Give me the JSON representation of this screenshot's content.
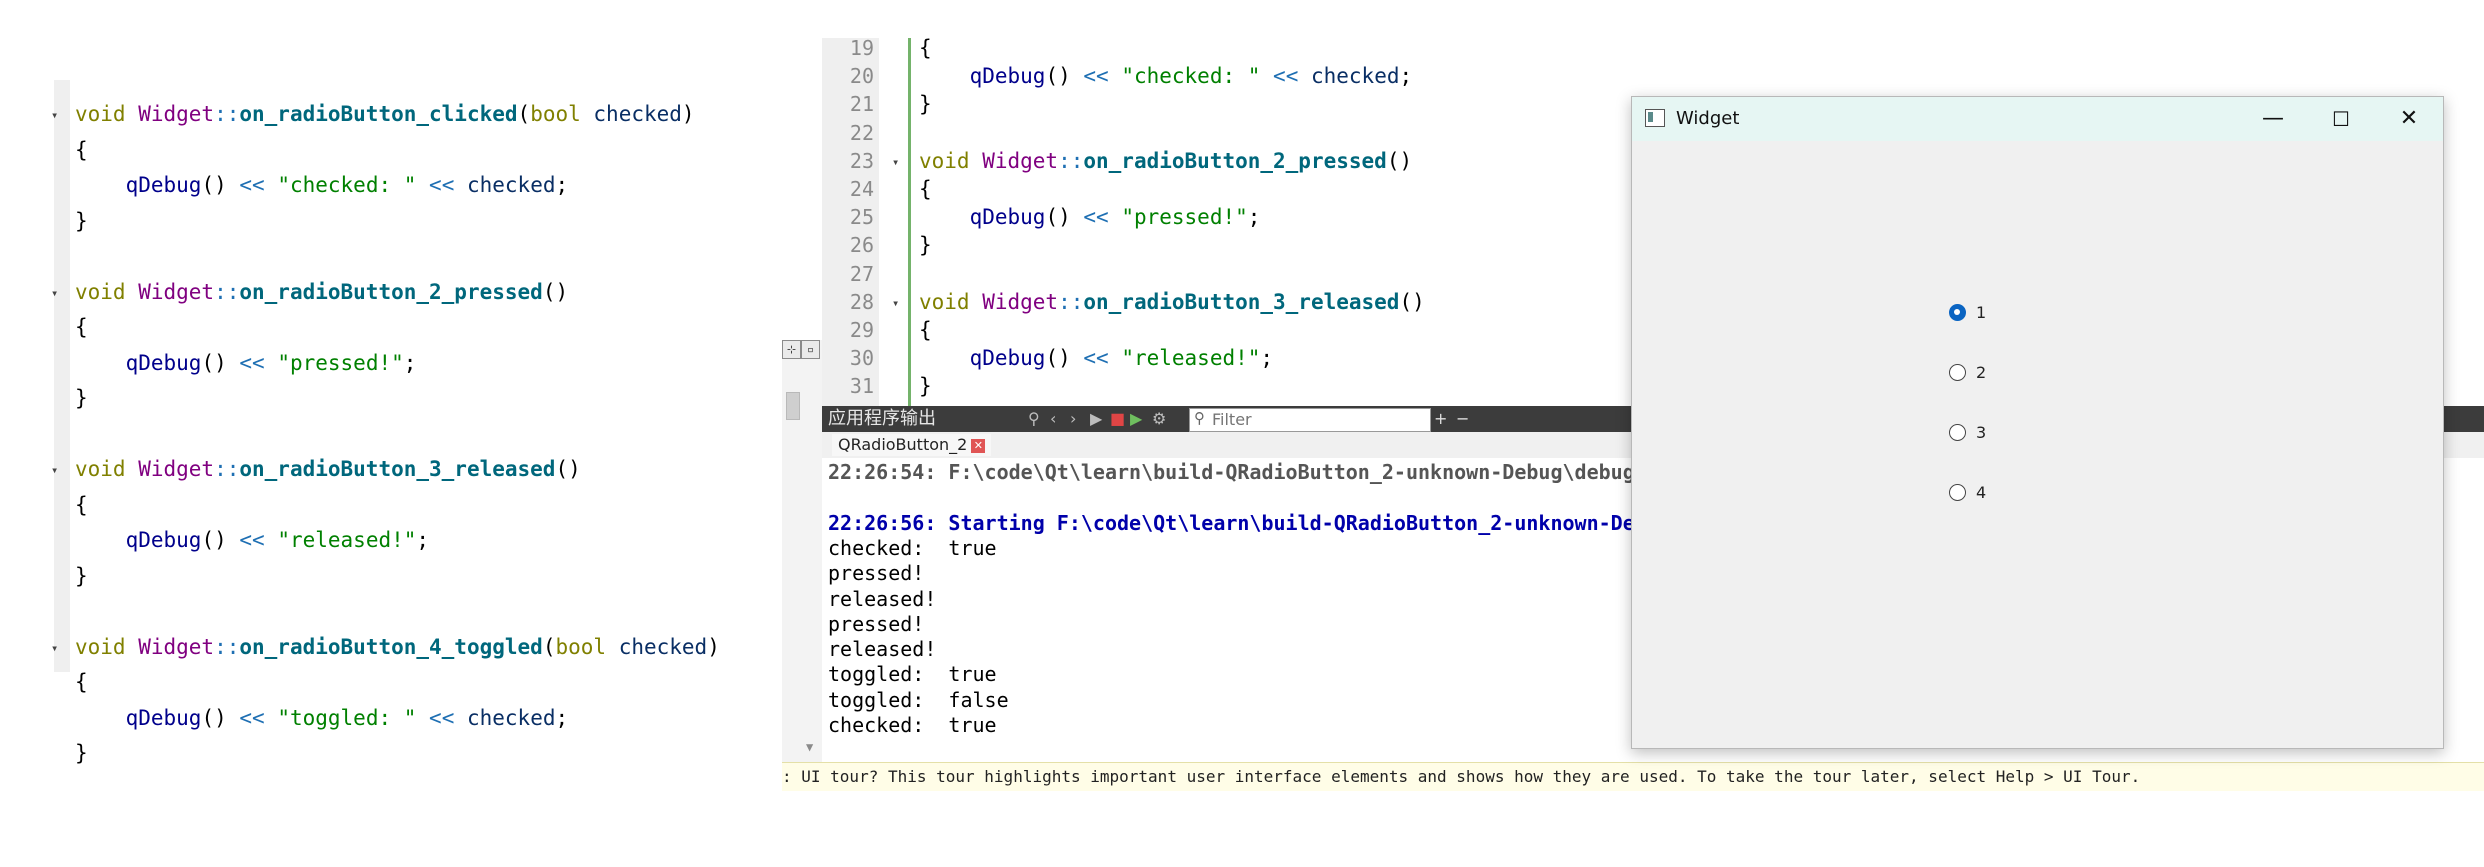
{
  "left_snippet": {
    "lines": [
      {
        "fold": true,
        "parts": [
          [
            "kw",
            "void "
          ],
          [
            "cls",
            "Widget"
          ],
          [
            "op",
            "::"
          ],
          [
            "fn",
            "on_radioButton_clicked"
          ],
          [
            "",
            "("
          ],
          [
            "kw",
            "bool "
          ],
          [
            "pm",
            "checked"
          ],
          [
            "",
            ")"
          ]
        ]
      },
      {
        "fold": false,
        "parts": [
          [
            "",
            "{"
          ]
        ]
      },
      {
        "fold": false,
        "parts": [
          [
            "",
            "    "
          ],
          [
            "call",
            "qDebug"
          ],
          [
            "",
            "() "
          ],
          [
            "op",
            "<<"
          ],
          [
            "str",
            " \"checked: \" "
          ],
          [
            "op",
            "<<"
          ],
          [
            "pm",
            " checked"
          ],
          [
            "",
            ";"
          ]
        ]
      },
      {
        "fold": false,
        "parts": [
          [
            "",
            "}"
          ]
        ]
      },
      {
        "fold": false,
        "parts": []
      },
      {
        "fold": true,
        "parts": [
          [
            "kw",
            "void "
          ],
          [
            "cls",
            "Widget"
          ],
          [
            "op",
            "::"
          ],
          [
            "fn",
            "on_radioButton_2_pressed"
          ],
          [
            "",
            "()"
          ]
        ]
      },
      {
        "fold": false,
        "parts": [
          [
            "",
            "{"
          ]
        ]
      },
      {
        "fold": false,
        "parts": [
          [
            "",
            "    "
          ],
          [
            "call",
            "qDebug"
          ],
          [
            "",
            "() "
          ],
          [
            "op",
            "<<"
          ],
          [
            "str",
            " \"pressed!\""
          ],
          [
            "",
            ";"
          ]
        ]
      },
      {
        "fold": false,
        "parts": [
          [
            "",
            "}"
          ]
        ]
      },
      {
        "fold": false,
        "parts": []
      },
      {
        "fold": true,
        "parts": [
          [
            "kw",
            "void "
          ],
          [
            "cls",
            "Widget"
          ],
          [
            "op",
            "::"
          ],
          [
            "fn",
            "on_radioButton_3_released"
          ],
          [
            "",
            "()"
          ]
        ]
      },
      {
        "fold": false,
        "parts": [
          [
            "",
            "{"
          ]
        ]
      },
      {
        "fold": false,
        "parts": [
          [
            "",
            "    "
          ],
          [
            "call",
            "qDebug"
          ],
          [
            "",
            "() "
          ],
          [
            "op",
            "<<"
          ],
          [
            "str",
            " \"released!\""
          ],
          [
            "",
            ";"
          ]
        ]
      },
      {
        "fold": false,
        "parts": [
          [
            "",
            "}"
          ]
        ]
      },
      {
        "fold": false,
        "parts": []
      },
      {
        "fold": true,
        "parts": [
          [
            "kw",
            "void "
          ],
          [
            "cls",
            "Widget"
          ],
          [
            "op",
            "::"
          ],
          [
            "fn",
            "on_radioButton_4_toggled"
          ],
          [
            "",
            "("
          ],
          [
            "kw",
            "bool "
          ],
          [
            "pm",
            "checked"
          ],
          [
            "",
            ")"
          ]
        ]
      },
      {
        "fold": false,
        "parts": [
          [
            "",
            "{"
          ]
        ]
      },
      {
        "fold": false,
        "parts": [
          [
            "",
            "    "
          ],
          [
            "call",
            "qDebug"
          ],
          [
            "",
            "() "
          ],
          [
            "op",
            "<<"
          ],
          [
            "str",
            " \"toggled: \" "
          ],
          [
            "op",
            "<<"
          ],
          [
            "pm",
            " checked"
          ],
          [
            "",
            ";"
          ]
        ]
      },
      {
        "fold": false,
        "parts": [
          [
            "",
            "}"
          ]
        ]
      }
    ]
  },
  "editor": {
    "lines": [
      {
        "num": "19",
        "fold": false,
        "parts": [
          [
            "",
            "{"
          ]
        ]
      },
      {
        "num": "20",
        "fold": false,
        "parts": [
          [
            "",
            "    "
          ],
          [
            "call",
            "qDebug"
          ],
          [
            "",
            "() "
          ],
          [
            "op",
            "<<"
          ],
          [
            "str",
            " \"checked: \" "
          ],
          [
            "op",
            "<<"
          ],
          [
            "pm",
            " checked"
          ],
          [
            "",
            ";"
          ]
        ]
      },
      {
        "num": "21",
        "fold": false,
        "parts": [
          [
            "",
            "}"
          ]
        ]
      },
      {
        "num": "22",
        "fold": false,
        "parts": []
      },
      {
        "num": "23",
        "fold": true,
        "parts": [
          [
            "kw",
            "void "
          ],
          [
            "cls",
            "Widget"
          ],
          [
            "op",
            "::"
          ],
          [
            "fn",
            "on_radioButton_2_pressed"
          ],
          [
            "",
            "()"
          ]
        ]
      },
      {
        "num": "24",
        "fold": false,
        "parts": [
          [
            "",
            "{"
          ]
        ]
      },
      {
        "num": "25",
        "fold": false,
        "parts": [
          [
            "",
            "    "
          ],
          [
            "call",
            "qDebug"
          ],
          [
            "",
            "() "
          ],
          [
            "op",
            "<<"
          ],
          [
            "str",
            " \"pressed!\""
          ],
          [
            "",
            ";"
          ]
        ]
      },
      {
        "num": "26",
        "fold": false,
        "parts": [
          [
            "",
            "}"
          ]
        ]
      },
      {
        "num": "27",
        "fold": false,
        "parts": []
      },
      {
        "num": "28",
        "fold": true,
        "parts": [
          [
            "kw",
            "void "
          ],
          [
            "cls",
            "Widget"
          ],
          [
            "op",
            "::"
          ],
          [
            "fn",
            "on_radioButton_3_released"
          ],
          [
            "",
            "()"
          ]
        ]
      },
      {
        "num": "29",
        "fold": false,
        "parts": [
          [
            "",
            "{"
          ]
        ]
      },
      {
        "num": "30",
        "fold": false,
        "parts": [
          [
            "",
            "    "
          ],
          [
            "call",
            "qDebug"
          ],
          [
            "",
            "() "
          ],
          [
            "op",
            "<<"
          ],
          [
            "str",
            " \"released!\""
          ],
          [
            "",
            ";"
          ]
        ]
      },
      {
        "num": "31",
        "fold": false,
        "parts": [
          [
            "",
            "}"
          ]
        ]
      }
    ]
  },
  "output_pane": {
    "title": "应用程序输出",
    "filter_placeholder": "Filter",
    "tab_label": "QRadioButton_2",
    "lines": [
      {
        "style": "gray",
        "text": "22:26:54: F:\\code\\Qt\\learn\\build-QRadioButton_2-unknown-Debug\\debug"
      },
      {
        "style": "",
        "text": ""
      },
      {
        "style": "blue",
        "text": "22:26:56: Starting F:\\code\\Qt\\learn\\build-QRadioButton_2-unknown-De"
      },
      {
        "style": "",
        "text": "checked:  true"
      },
      {
        "style": "",
        "text": "pressed!"
      },
      {
        "style": "",
        "text": "released!"
      },
      {
        "style": "",
        "text": "pressed!"
      },
      {
        "style": "",
        "text": "released!"
      },
      {
        "style": "",
        "text": "toggled:  true"
      },
      {
        "style": "",
        "text": "toggled:  false"
      },
      {
        "style": "",
        "text": "checked:  true"
      }
    ]
  },
  "status_tip": ": UI tour? This tour highlights important user interface elements and shows how they are used. To take the tour later, select Help > UI Tour.",
  "widget_window": {
    "title": "Widget",
    "radios": [
      {
        "label": "1",
        "checked": true
      },
      {
        "label": "2",
        "checked": false
      },
      {
        "label": "3",
        "checked": false
      },
      {
        "label": "4",
        "checked": false
      }
    ]
  }
}
